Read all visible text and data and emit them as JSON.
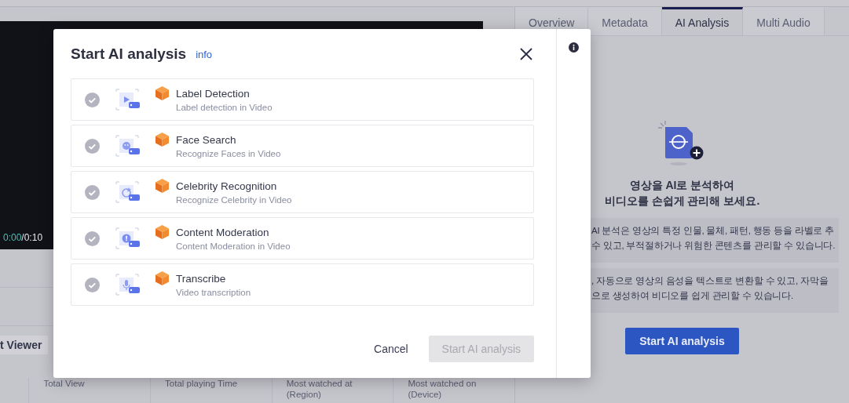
{
  "tabs": [
    {
      "label": "Overview",
      "selected": false
    },
    {
      "label": "Metadata",
      "selected": false
    },
    {
      "label": "AI Analysis",
      "selected": true
    },
    {
      "label": "Multi Audio",
      "selected": false
    }
  ],
  "player": {
    "current_time": "0:00",
    "duration": "/0:10"
  },
  "viewer_tab": {
    "label": "t Viewer"
  },
  "stats": [
    {
      "label": "Total View"
    },
    {
      "label": "Total playing Time"
    },
    {
      "label": "Most watched at (Region)"
    },
    {
      "label": "Most watched on (Device)"
    }
  ],
  "ai_panel": {
    "heading_lines": [
      "영상을 AI로 분석하여",
      "비디오를 손쉽게 관리해 보세요."
    ],
    "notes": [
      {
        "lines": [
          "AI 분석은 영상의 특정 인물, 물체, 패턴, 행동 등을 라벨로 추",
          "수 있고, 부적절하거나 위험한 콘텐츠를 관리할 수 있습니다."
        ]
      },
      {
        "lines": [
          ", 자동으로 영상의 음성을 텍스트로 변환할 수 있고, 자막을",
          "으로 생성하여 비디오를 쉽게 관리할 수 있습니다."
        ]
      }
    ],
    "button": "Start AI analysis"
  },
  "dialog": {
    "title": "Start AI analysis",
    "info_link": "info",
    "features": [
      {
        "kind": "label",
        "name": "Label Detection",
        "description": "Label detection in Video",
        "checked": false
      },
      {
        "kind": "face",
        "name": "Face Search",
        "description": "Recognize Faces in Video",
        "checked": false
      },
      {
        "kind": "celebrity",
        "name": "Celebrity Recognition",
        "description": "Recognize Celebrity in Video",
        "checked": false
      },
      {
        "kind": "moderation",
        "name": "Content Moderation",
        "description": "Content Moderation in Video",
        "checked": false
      },
      {
        "kind": "transcribe",
        "name": "Transcribe",
        "description": "Video transcription",
        "checked": false
      }
    ],
    "cancel": "Cancel",
    "submit": {
      "label": "Start AI analysis",
      "disabled": true
    }
  }
}
